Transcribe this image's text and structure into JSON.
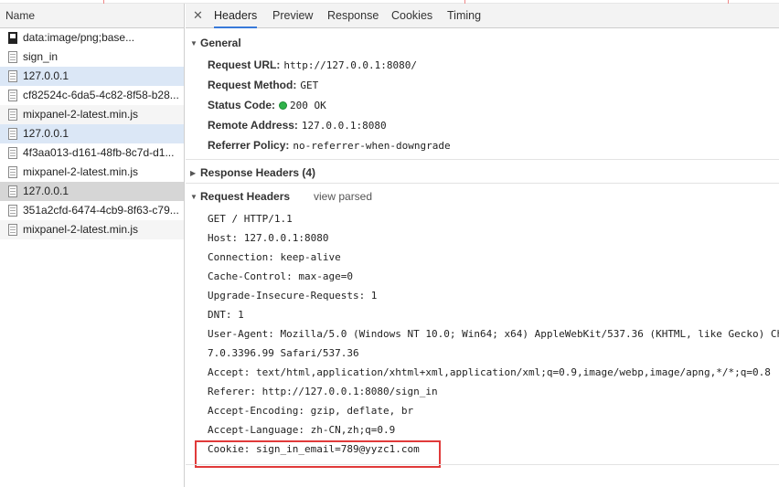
{
  "request_list": {
    "header": "Name",
    "items": [
      {
        "name": "data:image/png;base...",
        "icon": "image-file-icon",
        "state": "normal"
      },
      {
        "name": "sign_in",
        "icon": "document-file-icon",
        "state": "normal"
      },
      {
        "name": "127.0.0.1",
        "icon": "document-file-icon",
        "state": "highlighted"
      },
      {
        "name": "cf82524c-6da5-4c82-8f58-b28...",
        "icon": "document-file-icon",
        "state": "normal"
      },
      {
        "name": "mixpanel-2-latest.min.js",
        "icon": "document-file-icon",
        "state": "alt"
      },
      {
        "name": "127.0.0.1",
        "icon": "document-file-icon",
        "state": "highlighted"
      },
      {
        "name": "4f3aa013-d161-48fb-8c7d-d1...",
        "icon": "document-file-icon",
        "state": "normal"
      },
      {
        "name": "mixpanel-2-latest.min.js",
        "icon": "document-file-icon",
        "state": "normal"
      },
      {
        "name": "127.0.0.1",
        "icon": "document-file-icon",
        "state": "selected"
      },
      {
        "name": "351a2cfd-6474-4cb9-8f63-c79...",
        "icon": "document-file-icon",
        "state": "normal"
      },
      {
        "name": "mixpanel-2-latest.min.js",
        "icon": "document-file-icon",
        "state": "alt"
      }
    ]
  },
  "tabs": {
    "close_symbol": "✕",
    "items": [
      "Headers",
      "Preview",
      "Response",
      "Cookies",
      "Timing"
    ],
    "active": "Headers"
  },
  "general": {
    "title": "General",
    "request_url_label": "Request URL:",
    "request_url": "http://127.0.0.1:8080/",
    "request_method_label": "Request Method:",
    "request_method": "GET",
    "status_code_label": "Status Code:",
    "status_code": "200 OK",
    "remote_address_label": "Remote Address:",
    "remote_address": "127.0.0.1:8080",
    "referrer_policy_label": "Referrer Policy:",
    "referrer_policy": "no-referrer-when-downgrade"
  },
  "response_headers": {
    "title": "Response Headers (4)"
  },
  "request_headers": {
    "title": "Request Headers",
    "view_parsed": "view parsed",
    "lines": [
      "GET / HTTP/1.1",
      "Host: 127.0.0.1:8080",
      "Connection: keep-alive",
      "Cache-Control: max-age=0",
      "Upgrade-Insecure-Requests: 1",
      "DNT: 1",
      "User-Agent: Mozilla/5.0 (Windows NT 10.0; Win64; x64) AppleWebKit/537.36 (KHTML, like Gecko) Ch",
      "7.0.3396.99 Safari/537.36",
      "Accept: text/html,application/xhtml+xml,application/xml;q=0.9,image/webp,image/apng,*/*;q=0.8",
      "Referer: http://127.0.0.1:8080/sign_in",
      "Accept-Encoding: gzip, deflate, br",
      "Accept-Language: zh-CN,zh;q=0.9",
      "Cookie: sign_in_email=789@yyzc1.com"
    ]
  },
  "colors": {
    "accent": "#3879d9",
    "status_ok": "#2fb24a",
    "highlight_box": "#e03a3a",
    "selected_row": "#d6d6d6",
    "highlighted_row": "#dbe7f6"
  }
}
